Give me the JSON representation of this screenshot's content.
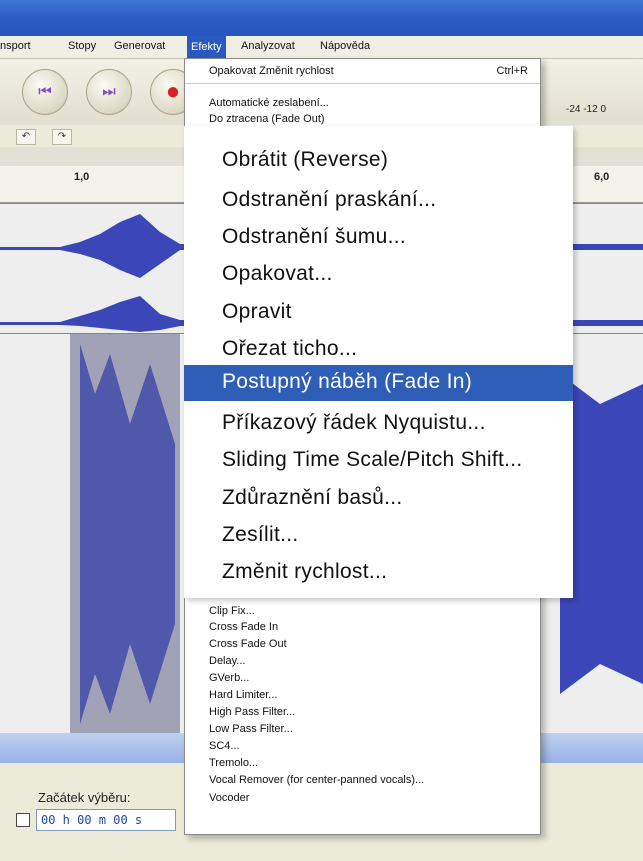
{
  "menubar": {
    "items": [
      "nsport",
      "Stopy",
      "Generovat",
      "Efekty",
      "Analyzovat",
      "Nápověda"
    ]
  },
  "toolbar": {
    "meter_labels": "-24  -12  0"
  },
  "ruler": {
    "labels": [
      "1,0",
      "6,0"
    ]
  },
  "effects_menu": {
    "repeat_label": "Opakovat Změnit rychlost",
    "repeat_shortcut": "Ctrl+R",
    "small_top_items": [
      "Automatické zeslabení...",
      "Do ztracena (Fade Out)"
    ],
    "large_items": [
      "Obrátit (Reverse)",
      "Odstranění praskání...",
      "Odstranění šumu...",
      "Opakovat...",
      "Opravit",
      "Ořezat ticho...",
      "Postupný náběh (Fade In)",
      "Příkazový řádek Nyquistu...",
      "Sliding Time Scale/Pitch Shift...",
      "Zdůraznění basů...",
      "Zesílit...",
      "Změnit rychlost..."
    ],
    "highlighted_item": "Postupný náběh (Fade In)",
    "small_bottom_items": [
      "Clip Fix...",
      "Cross Fade In",
      "Cross Fade Out",
      "Delay...",
      "GVerb...",
      "Hard Limiter...",
      "High Pass Filter...",
      "Low Pass Filter...",
      "SC4...",
      "Tremolo...",
      "Vocal Remover (for center-panned vocals)...",
      "Vocoder"
    ]
  },
  "status": {
    "selection_start_label": "Začátek výběru:",
    "time_value": "00 h 00 m 00 s"
  },
  "colors": {
    "accent": "#2f5eb6",
    "waveform": "#3b47b8"
  }
}
